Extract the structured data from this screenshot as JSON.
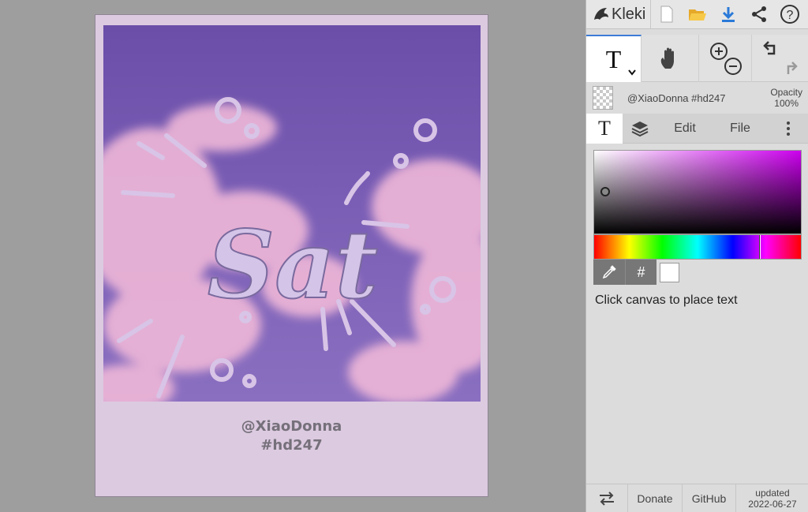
{
  "app": {
    "name": "Kleki"
  },
  "topbar": {
    "icons": [
      "new-file-icon",
      "open-folder-icon",
      "download-icon",
      "share-icon",
      "help-icon"
    ],
    "help_glyph": "?"
  },
  "toolbar": {
    "text_tool_glyph": "T",
    "icons": [
      "text-tool-icon",
      "hand-tool-icon",
      "zoom-in-icon",
      "zoom-out-icon",
      "undo-icon",
      "redo-icon"
    ]
  },
  "layer": {
    "name": "@XiaoDonna #hd247",
    "opacity_label": "Opacity",
    "opacity_value": "100%"
  },
  "tabs": {
    "brush_glyph": "T",
    "edit": "Edit",
    "file": "File"
  },
  "color": {
    "hex_label": "#",
    "primary": "#ffffff",
    "accent": "#3c7bd6"
  },
  "hint": "Click canvas to place text",
  "footer": {
    "donate": "Donate",
    "github": "GitHub",
    "updated_label": "updated",
    "updated_date": "2022-06-27"
  },
  "canvas": {
    "artwork_text": "Sat",
    "caption_line1": "@XiaoDonna",
    "caption_line2": "#hd247"
  }
}
